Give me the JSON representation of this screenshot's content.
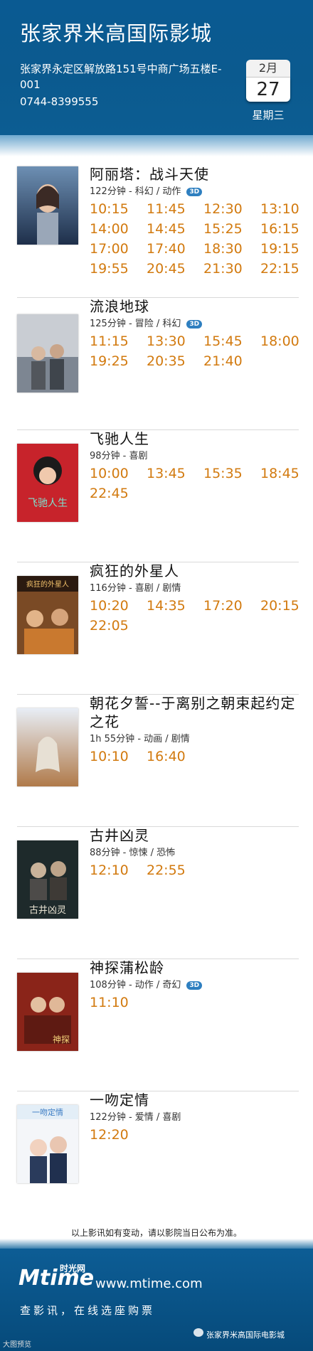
{
  "header": {
    "cinema_name": "张家界米高国际影城",
    "address": "张家界永定区解放路151号中商广场五楼E-001",
    "phone": "0744-8399555",
    "date": {
      "month": "2月",
      "day": "27",
      "weekday": "星期三"
    }
  },
  "movies": [
    {
      "title": "阿丽塔：战斗天使",
      "meta": "122分钟 - 科幻 / 动作",
      "is_3d": true,
      "showtimes": [
        "10:15",
        "11:45",
        "12:30",
        "13:10",
        "14:00",
        "14:45",
        "15:25",
        "16:15",
        "17:00",
        "17:40",
        "18:30",
        "19:15",
        "19:55",
        "20:45",
        "21:30",
        "22:15"
      ]
    },
    {
      "title": "流浪地球",
      "meta": "125分钟 - 冒险 / 科幻",
      "is_3d": true,
      "showtimes": [
        "11:15",
        "13:30",
        "15:45",
        "18:00",
        "19:25",
        "20:35",
        "21:40"
      ]
    },
    {
      "title": "飞驰人生",
      "meta": "98分钟 - 喜剧",
      "is_3d": false,
      "showtimes": [
        "10:00",
        "13:45",
        "15:35",
        "18:45",
        "22:45"
      ]
    },
    {
      "title": "疯狂的外星人",
      "meta": "116分钟 - 喜剧 / 剧情",
      "is_3d": false,
      "showtimes": [
        "10:20",
        "14:35",
        "17:20",
        "20:15",
        "22:05"
      ]
    },
    {
      "title": "朝花夕誓--于离别之朝束起约定之花",
      "meta": "1h 55分钟 - 动画 / 剧情",
      "is_3d": false,
      "showtimes": [
        "10:10",
        "16:40"
      ]
    },
    {
      "title": "古井凶灵",
      "meta": "88分钟 - 惊悚 / 恐怖",
      "is_3d": false,
      "showtimes": [
        "12:10",
        "22:55"
      ]
    },
    {
      "title": "神探蒲松龄",
      "meta": "108分钟 - 动作 / 奇幻",
      "is_3d": true,
      "showtimes": [
        "11:10"
      ]
    },
    {
      "title": "一吻定情",
      "meta": "122分钟 - 爱情 / 喜剧",
      "is_3d": false,
      "showtimes": [
        "12:20"
      ]
    }
  ],
  "badge_3d_label": "3D",
  "notice": "以上影讯如有变动，请以影院当日公布为准。",
  "footer": {
    "logo_m": "Mtime",
    "logo_cn": "时光网",
    "site_url": "www.mtime.com",
    "slogan": "查影讯，在线选座购票",
    "wechat_account": "张家界米高国际电影城",
    "watermark": "大图预览"
  },
  "colors": {
    "header_blue": "#0b5a8f",
    "showtime_orange": "#d27a0f",
    "badge_blue": "#2e7fc0"
  }
}
